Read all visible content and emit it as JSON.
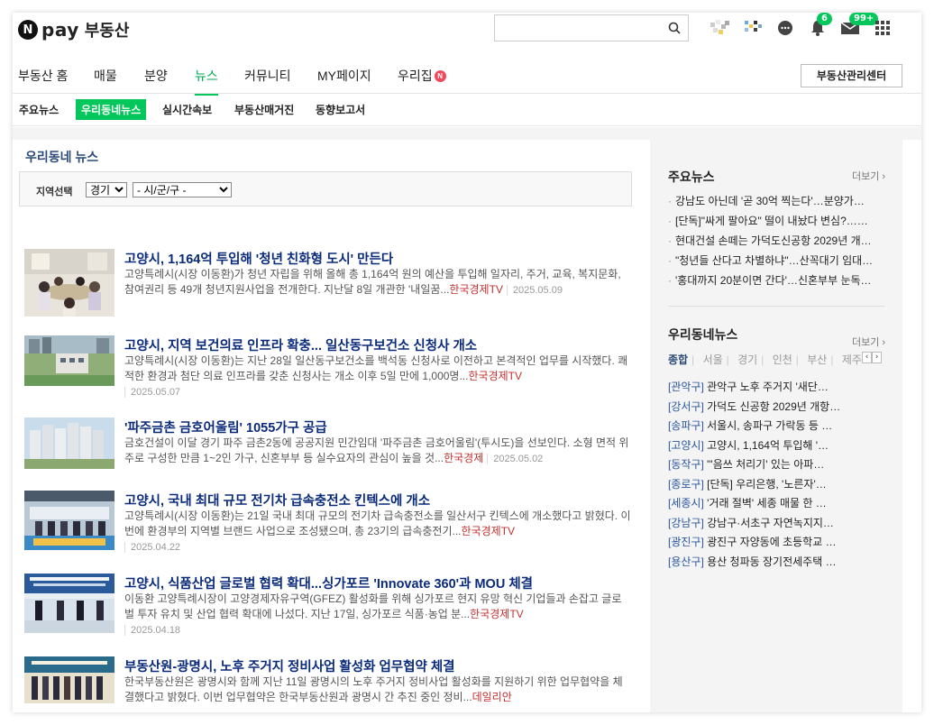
{
  "header": {
    "logo_letter": "N",
    "logo_pay": "pay",
    "logo_service": "부동산",
    "search_placeholder": "",
    "badges": {
      "notifications": "6",
      "mail": "99+"
    }
  },
  "gnb": {
    "items": [
      {
        "label": "부동산 홈"
      },
      {
        "label": "매물"
      },
      {
        "label": "분양"
      },
      {
        "label": "뉴스"
      },
      {
        "label": "커뮤니티"
      },
      {
        "label": "MY페이지"
      },
      {
        "label": "우리집"
      }
    ],
    "new_badge": "N",
    "manager_button": "부동산관리센터"
  },
  "lnb": {
    "items": [
      {
        "label": "주요뉴스"
      },
      {
        "label": "우리동네뉴스"
      },
      {
        "label": "실시간속보"
      },
      {
        "label": "부동산매거진"
      },
      {
        "label": "동향보고서"
      }
    ]
  },
  "main": {
    "section_title": "우리동네 뉴스",
    "region_label": "지역선택",
    "region_select": "경기",
    "city_select": "- 시/군/구 -",
    "news": [
      {
        "title": "고양시, 1,164억 투입해 '청년 친화형 도시' 만든다",
        "body": "고양특례시(시장 이동환)가 청년 자립을 위해 올해 총 1,164억 원의 예산을 투입해 일자리, 주거, 교육, 복지문화, 참여권리 등 49개 청년지원사업을 전개한다. 지난달 8일 개관한 '내일꿈...",
        "source": "한국경제TV",
        "date": "2025.05.09"
      },
      {
        "title": "고양시, 지역 보건의료 인프라 확충... 일산동구보건소 신청사 개소",
        "body": "고양특례시(시장 이동환)는 지난 28일 일산동구보건소를 백석동 신청사로 이전하고 본격적인 업무를 시작했다. 쾌적한 환경과 첨단 의료 인프라를 갖춘 신청사는 개소 이후 5일 만에 1,000명...",
        "source": "한국경제TV",
        "date": "2025.05.07"
      },
      {
        "title": "'파주금촌 금호어울림' 1055가구 공급",
        "body": "금호건설이 이달 경기 파주 금촌2동에 공공지원 민간임대 '파주금촌 금호어울림'(투시도)을 선보인다. 소형 면적 위주로 구성한 만큼 1~2인 가구, 신혼부부 등 실수요자의 관심이 높을 것...",
        "source": "한국경제",
        "date": "2025.05.02"
      },
      {
        "title": "고양시, 국내 최대 규모 전기차 급속충전소 킨텍스에 개소",
        "body": "고양특례시(시장 이동환)는 21일 국내 최대 규모의 전기차 급속충전소를 일산서구 킨텍스에 개소했다고 밝혔다. 이번에 환경부의 지역별 브랜드 사업으로 조성됐으며, 총 23기의 급속충전기...",
        "source": "한국경제TV",
        "date": "2025.04.22"
      },
      {
        "title": "고양시, 식품산업 글로벌 협력 확대...싱가포르 'Innovate 360'과 MOU 체결",
        "body": "이동환 고양특례시장이 고양경제자유구역(GFEZ) 활성화를 위해 싱가포르 현지 유망 혁신 기업들과 손잡고 글로벌 투자 유치 및 산업 협력 확대에 나섰다. 지난 17일, 싱가포르 식품·농업 분...",
        "source": "한국경제TV",
        "date": "2025.04.18"
      },
      {
        "title": "부동산원-광명시, 노후 주거지 정비사업 활성화 업무협약 체결",
        "body": "한국부동산원은 광명시와 함께 지난 11일 광명시의 노후 주거지 정비사업 활성화를 지원하기 위한 업무협약을 체결했다고 밝혔다. 이번 업무협약은 한국부동산원과 광명시 간 추진 중인 정비...",
        "source": "데일리안",
        "date": ""
      }
    ]
  },
  "sidebar": {
    "main_news_title": "주요뉴스",
    "more_label": "더보기",
    "main_news": [
      "강남도 아닌데 '곧 30억 찍는다'…분양가…",
      "[단독]\"싸게 팔아요\" 떨이 내놨다 변심?……",
      "현대건설 손떼는 가덕도신공항 2029년 개…",
      "\"청년들 산다고 차별하냐\"…산꼭대기 임대…",
      "'홍대까지 20분이면 간다'…신혼부부 눈독…"
    ],
    "local_news_title": "우리동네뉴스",
    "local_more_label": "더보기",
    "local_tabs": [
      "종합",
      "서울",
      "경기",
      "인천",
      "부산",
      "제주"
    ],
    "local_news": [
      {
        "gu": "[관악구]",
        "text": "관악구 노후 주거지 '새단…"
      },
      {
        "gu": "[강서구]",
        "text": "가덕도 신공항 2029년 개항…"
      },
      {
        "gu": "[송파구]",
        "text": "서울시, 송파구 가락동 등 …"
      },
      {
        "gu": "[고양시]",
        "text": "고양시, 1,164억 투입해 '…"
      },
      {
        "gu": "[동작구]",
        "text": "\"'음쓰 처리기' 있는 아파…"
      },
      {
        "gu": "[종로구]",
        "text": "[단독] 우리은행, '노른자'…"
      },
      {
        "gu": "[세종시]",
        "text": "'거래 절벽' 세종 매물 한 …"
      },
      {
        "gu": "[강남구]",
        "text": "강남구·서초구 자연녹지지…"
      },
      {
        "gu": "[광진구]",
        "text": "광진구 자양동에 초등학교 …"
      },
      {
        "gu": "[용산구]",
        "text": "용산 청파동 장기전세주택 …"
      }
    ]
  }
}
